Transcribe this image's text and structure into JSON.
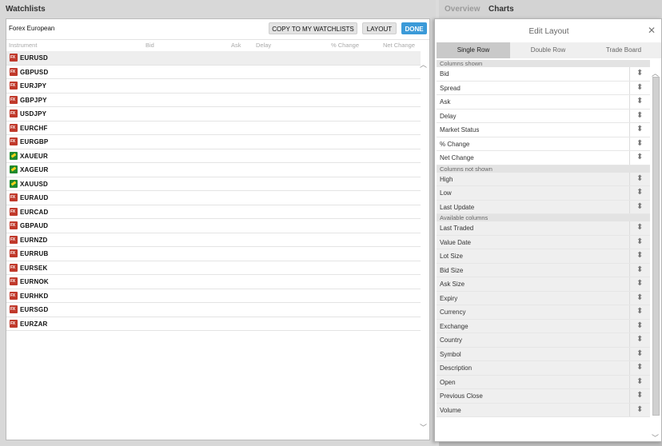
{
  "watchlists": {
    "title": "Watchlists",
    "list_name": "Forex European",
    "copy_label": "COPY TO MY WATCHLISTS",
    "layout_label": "LAYOUT",
    "done_label": "DONE",
    "columns": [
      "Instrument",
      "Bid",
      "Ask",
      "Delay",
      "% Change",
      "Net Change"
    ],
    "instruments": [
      {
        "symbol": "EURUSD",
        "icon": "fx-icon"
      },
      {
        "symbol": "GBPUSD",
        "icon": "fx-icon"
      },
      {
        "symbol": "EURJPY",
        "icon": "fx-icon"
      },
      {
        "symbol": "GBPJPY",
        "icon": "fx-icon"
      },
      {
        "symbol": "USDJPY",
        "icon": "fx-icon"
      },
      {
        "symbol": "EURCHF",
        "icon": "fx-icon"
      },
      {
        "symbol": "EURGBP",
        "icon": "fx-icon"
      },
      {
        "symbol": "XAUEUR",
        "icon": "metal-icon"
      },
      {
        "symbol": "XAGEUR",
        "icon": "metal-icon"
      },
      {
        "symbol": "XAUUSD",
        "icon": "metal-icon"
      },
      {
        "symbol": "EURAUD",
        "icon": "fx-icon"
      },
      {
        "symbol": "EURCAD",
        "icon": "fx-icon"
      },
      {
        "symbol": "GBPAUD",
        "icon": "fx-icon"
      },
      {
        "symbol": "EURNZD",
        "icon": "fx-icon"
      },
      {
        "symbol": "EURRUB",
        "icon": "fx-icon"
      },
      {
        "symbol": "EURSEK",
        "icon": "fx-icon"
      },
      {
        "symbol": "EURNOK",
        "icon": "fx-icon"
      },
      {
        "symbol": "EURHKD",
        "icon": "fx-icon"
      },
      {
        "symbol": "EURSGD",
        "icon": "fx-icon"
      },
      {
        "symbol": "EURZAR",
        "icon": "fx-icon"
      }
    ]
  },
  "right_tabs": {
    "overview": "Overview",
    "charts": "Charts"
  },
  "edit_layout": {
    "title": "Edit Layout",
    "close_icon": "close-icon",
    "tabs": [
      "Single Row",
      "Double Row",
      "Trade Board"
    ],
    "active_tab": "Single Row",
    "sections": [
      {
        "title": "Columns shown",
        "items": [
          "Bid",
          "Spread",
          "Ask",
          "Delay",
          "Market Status",
          "% Change",
          "Net Change"
        ]
      },
      {
        "title": "Columns not shown",
        "items": [
          "High",
          "Low",
          "Last Update"
        ]
      },
      {
        "title": "Available columns",
        "items": [
          "Last Traded",
          "Value Date",
          "Lot Size",
          "Bid Size",
          "Ask Size",
          "Expiry",
          "Currency",
          "Exchange",
          "Country",
          "Symbol",
          "Description",
          "Open",
          "Previous Close",
          "Volume"
        ]
      }
    ]
  },
  "colors": {
    "done_button": "#3b9ad8",
    "fx_icon": "#c0392b",
    "metal_icon": "#1f8a2e"
  }
}
